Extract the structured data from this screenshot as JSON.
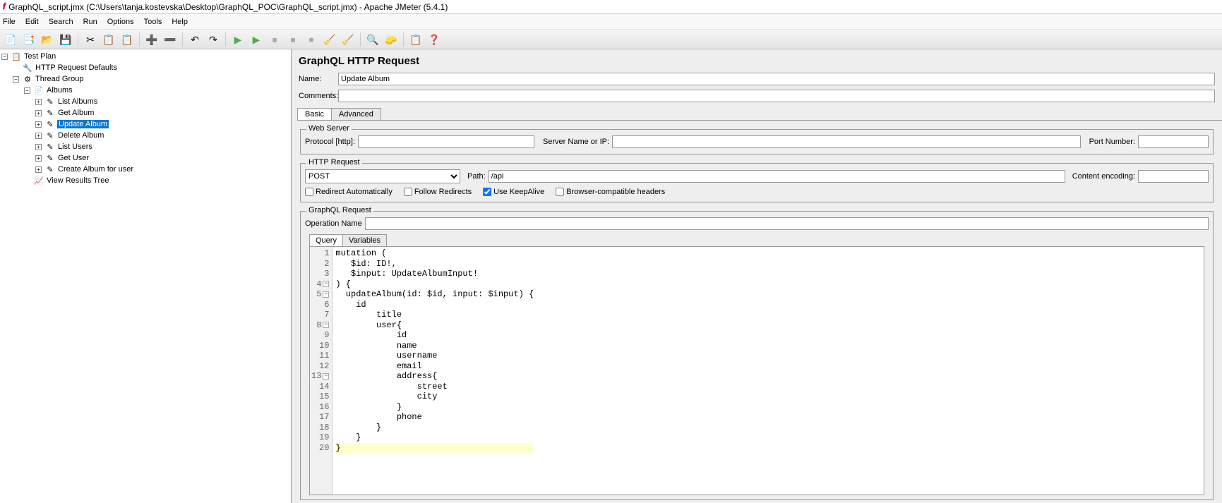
{
  "window": {
    "title": "GraphQL_script.jmx (C:\\Users\\tanja.kostevska\\Desktop\\GraphQL_POC\\GraphQL_script.jmx) - Apache JMeter (5.4.1)"
  },
  "menu": [
    "File",
    "Edit",
    "Search",
    "Run",
    "Options",
    "Tools",
    "Help"
  ],
  "tree": {
    "root": "Test Plan",
    "children": [
      {
        "label": "HTTP Request Defaults",
        "icon": "🔧"
      },
      {
        "label": "Thread Group",
        "icon": "⚙",
        "expanded": true,
        "children": [
          {
            "label": "Albums",
            "icon": "📄",
            "expanded": true,
            "children": [
              {
                "label": "List Albums",
                "icon": "✎"
              },
              {
                "label": "Get Album",
                "icon": "✎"
              },
              {
                "label": "Update Album",
                "icon": "✎",
                "selected": true
              },
              {
                "label": "Delete Album",
                "icon": "✎"
              },
              {
                "label": "List Users",
                "icon": "✎"
              },
              {
                "label": "Get  User",
                "icon": "✎"
              },
              {
                "label": "Create Album for user",
                "icon": "✎"
              }
            ]
          },
          {
            "label": "View Results Tree",
            "icon": "📈"
          }
        ]
      }
    ]
  },
  "panel": {
    "title": "GraphQL HTTP Request",
    "name_label": "Name:",
    "name_value": "Update Album",
    "comments_label": "Comments:",
    "comments_value": "",
    "tabs": [
      "Basic",
      "Advanced"
    ],
    "active_tab": 0,
    "webserver": {
      "legend": "Web Server",
      "protocol_label": "Protocol [http]:",
      "protocol_value": "",
      "server_label": "Server Name or IP:",
      "server_value": "",
      "port_label": "Port Number:",
      "port_value": ""
    },
    "httprequest": {
      "legend": "HTTP Request",
      "method": "POST",
      "path_label": "Path:",
      "path_value": "/api",
      "encoding_label": "Content encoding:",
      "encoding_value": "",
      "redirect_auto": "Redirect Automatically",
      "follow_redirects": "Follow Redirects",
      "keepalive": "Use KeepAlive",
      "browser_compat": "Browser-compatible headers"
    },
    "graphql": {
      "legend": "GraphQL Request",
      "opname_label": "Operation Name",
      "opname_value": ""
    },
    "subtabs": [
      "Query",
      "Variables"
    ],
    "active_subtab": 0,
    "code_lines": [
      {
        "n": 1,
        "text": "mutation (",
        "fold": ""
      },
      {
        "n": 2,
        "text": "   $id: ID!,",
        "fold": ""
      },
      {
        "n": 3,
        "text": "   $input: UpdateAlbumInput!",
        "fold": ""
      },
      {
        "n": 4,
        "text": ") {",
        "fold": "⊟"
      },
      {
        "n": 5,
        "text": "  updateAlbum(id: $id, input: $input) {",
        "fold": "⊟"
      },
      {
        "n": 6,
        "text": "    id",
        "fold": ""
      },
      {
        "n": 7,
        "text": "        title",
        "fold": ""
      },
      {
        "n": 8,
        "text": "        user{",
        "fold": "⊟"
      },
      {
        "n": 9,
        "text": "            id",
        "fold": ""
      },
      {
        "n": 10,
        "text": "            name",
        "fold": ""
      },
      {
        "n": 11,
        "text": "            username",
        "fold": ""
      },
      {
        "n": 12,
        "text": "            email",
        "fold": ""
      },
      {
        "n": 13,
        "text": "            address{",
        "fold": "⊟"
      },
      {
        "n": 14,
        "text": "                street",
        "fold": ""
      },
      {
        "n": 15,
        "text": "                city",
        "fold": ""
      },
      {
        "n": 16,
        "text": "            }",
        "fold": ""
      },
      {
        "n": 17,
        "text": "            phone",
        "fold": ""
      },
      {
        "n": 18,
        "text": "        }",
        "fold": ""
      },
      {
        "n": 19,
        "text": "    }",
        "fold": ""
      },
      {
        "n": 20,
        "text": "}",
        "fold": "",
        "hl": true
      }
    ]
  },
  "toolbar_icons": [
    {
      "name": "new-icon",
      "char": "📄"
    },
    {
      "name": "templates-icon",
      "char": "📑"
    },
    {
      "name": "open-icon",
      "char": "📂"
    },
    {
      "name": "save-icon",
      "char": "💾"
    },
    {
      "name": "cut-icon",
      "char": "✂",
      "sep_before": true
    },
    {
      "name": "copy-icon",
      "char": "📋"
    },
    {
      "name": "paste-icon",
      "char": "📋"
    },
    {
      "name": "add-icon",
      "char": "➕",
      "sep_before": true
    },
    {
      "name": "remove-icon",
      "char": "➖"
    },
    {
      "name": "undo-icon",
      "char": "↶",
      "sep_before": true
    },
    {
      "name": "redo-icon",
      "char": "↷"
    },
    {
      "name": "run-icon",
      "char": "▶",
      "color": "#4caf50",
      "sep_before": true
    },
    {
      "name": "run-noTimer-icon",
      "char": "▶",
      "color": "#4caf50"
    },
    {
      "name": "stop-icon",
      "char": "⏹",
      "color": "#aaa"
    },
    {
      "name": "shutdown-icon",
      "char": "⏹",
      "color": "#aaa"
    },
    {
      "name": "toggle-icon",
      "char": "⏺",
      "color": "#aaa"
    },
    {
      "name": "clear-icon",
      "char": "🧹"
    },
    {
      "name": "clear-all-icon",
      "char": "🧹"
    },
    {
      "name": "search-icon",
      "char": "🔍",
      "sep_before": true
    },
    {
      "name": "reset-search-icon",
      "char": "🧽"
    },
    {
      "name": "function-helper-icon",
      "char": "📋",
      "sep_before": true
    },
    {
      "name": "help-icon",
      "char": "❓",
      "color": "#1565c0"
    }
  ]
}
